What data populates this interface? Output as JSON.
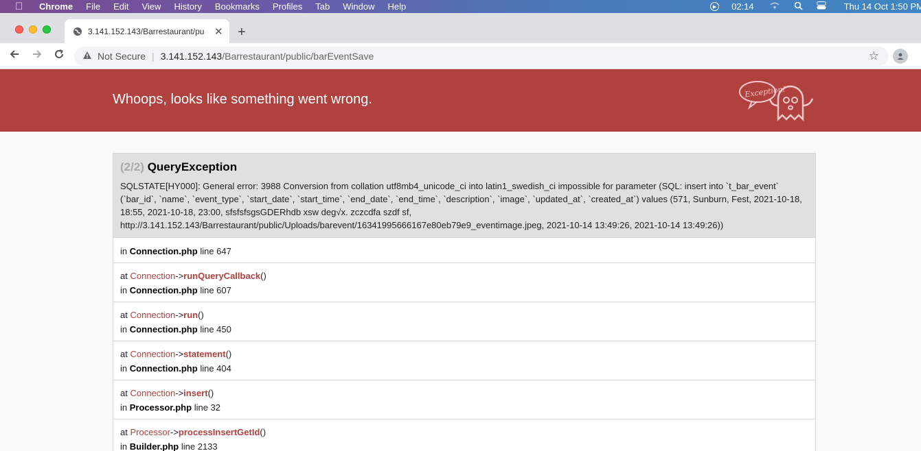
{
  "menubar": {
    "app": "Chrome",
    "items": [
      "File",
      "Edit",
      "View",
      "History",
      "Bookmarks",
      "Profiles",
      "Tab",
      "Window",
      "Help"
    ],
    "timer": "02:14",
    "datetime": "Thu 14 Oct  1:50 PM"
  },
  "browser": {
    "tab_title": "3.141.152.143/Barrestaurant/pu",
    "security": "Not Secure",
    "url_host": "3.141.152.143",
    "url_path": "/Barrestaurant/public/barEventSave"
  },
  "page": {
    "header_title": "Whoops, looks like something went wrong.",
    "logo_text": "Exception!",
    "exception": {
      "count": "(2/2)",
      "name": "QueryException",
      "message": "SQLSTATE[HY000]: General error: 3988 Conversion from collation utf8mb4_unicode_ci into latin1_swedish_ci impossible for parameter (SQL: insert into `t_bar_event` (`bar_id`, `name`, `event_type`, `start_date`, `start_time`, `end_date`, `end_time`, `description`, `image`, `updated_at`, `created_at`) values (571, Sunburn, Fest, 2021-10-18, 18:55, 2021-10-18, 23:00, sfsfsfsgsGDERhdb xsw deg√x. zczcdfa szdf sf, http://3.141.152.143/Barrestaurant/public/Uploads/barevent/16341995666167e80eb79e9_eventimage.jpeg, 2021-10-14 13:49:26, 2021-10-14 13:49:26))"
    },
    "first_location": {
      "in": "in",
      "file": "Connection.php",
      "line": "line 647"
    },
    "traces": [
      {
        "at": "at",
        "class": "Connection",
        "arrow": "->",
        "fn": "runQueryCallback",
        "parens": "()",
        "in": "in",
        "file": "Connection.php",
        "line": "line 607"
      },
      {
        "at": "at",
        "class": "Connection",
        "arrow": "->",
        "fn": "run",
        "parens": "()",
        "in": "in",
        "file": "Connection.php",
        "line": "line 450"
      },
      {
        "at": "at",
        "class": "Connection",
        "arrow": "->",
        "fn": "statement",
        "parens": "()",
        "in": "in",
        "file": "Connection.php",
        "line": "line 404"
      },
      {
        "at": "at",
        "class": "Connection",
        "arrow": "->",
        "fn": "insert",
        "parens": "()",
        "in": "in",
        "file": "Processor.php",
        "line": "line 32"
      },
      {
        "at": "at",
        "class": "Processor",
        "arrow": "->",
        "fn": "processInsertGetId",
        "parens": "()",
        "in": "in",
        "file": "Builder.php",
        "line": "line 2133"
      }
    ]
  },
  "colors": {
    "header": "#b0413e",
    "accent": "#b0413e"
  }
}
